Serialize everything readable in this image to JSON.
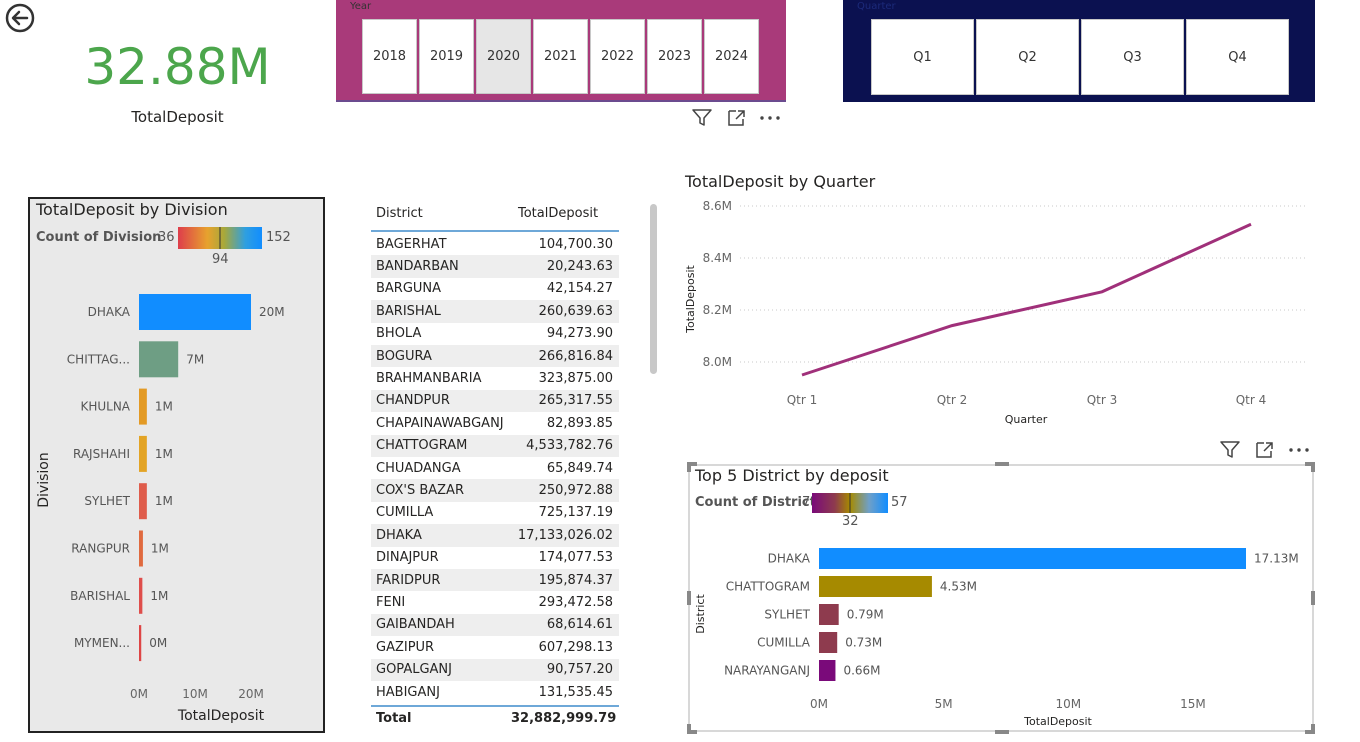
{
  "kpi": {
    "value": "32.88M",
    "label": "TotalDeposit"
  },
  "year_slicer": {
    "label": "Year",
    "years": [
      "2018",
      "2019",
      "2020",
      "2021",
      "2022",
      "2023",
      "2024"
    ],
    "selected": "2020"
  },
  "quarter_slicer": {
    "label": "Quarter",
    "quarters": [
      "Q1",
      "Q2",
      "Q3",
      "Q4"
    ]
  },
  "colors": {
    "kpi_green": "#4CA64C",
    "year_slicer_bg": "#A93A7A",
    "quarter_slicer_bg": "#0B1150",
    "line_color": "#A0307A",
    "table_accent": "#6ea8d8"
  },
  "icons": [
    "back-arrow-icon",
    "filter-icon",
    "focus-mode-icon",
    "more-options-icon"
  ],
  "division_chart": {
    "title": "TotalDeposit by Division",
    "legend_label": "Count of Division",
    "legend_min": "36",
    "legend_mid": "94",
    "legend_max": "152"
  },
  "district_table": {
    "headers": [
      "District",
      "TotalDeposit"
    ],
    "rows": [
      [
        "BAGERHAT",
        "104,700.30"
      ],
      [
        "BANDARBAN",
        "20,243.63"
      ],
      [
        "BARGUNA",
        "42,154.27"
      ],
      [
        "BARISHAL",
        "260,639.63"
      ],
      [
        "BHOLA",
        "94,273.90"
      ],
      [
        "BOGURA",
        "266,816.84"
      ],
      [
        "BRAHMANBARIA",
        "323,875.00"
      ],
      [
        "CHANDPUR",
        "265,317.55"
      ],
      [
        "CHAPAINAWABGANJ",
        "82,893.85"
      ],
      [
        "CHATTOGRAM",
        "4,533,782.76"
      ],
      [
        "CHUADANGA",
        "65,849.74"
      ],
      [
        "COX'S BAZAR",
        "250,972.88"
      ],
      [
        "CUMILLA",
        "725,137.19"
      ],
      [
        "DHAKA",
        "17,133,026.02"
      ],
      [
        "DINAJPUR",
        "174,077.53"
      ],
      [
        "FARIDPUR",
        "195,874.37"
      ],
      [
        "FENI",
        "293,472.58"
      ],
      [
        "GAIBANDAH",
        "68,614.61"
      ],
      [
        "GAZIPUR",
        "607,298.13"
      ],
      [
        "GOPALGANJ",
        "90,757.20"
      ],
      [
        "HABIGANJ",
        "131,535.45"
      ]
    ],
    "total_label": "Total",
    "total_value": "32,882,999.79"
  },
  "quarter_chart": {
    "title": "TotalDeposit by Quarter"
  },
  "top5_chart": {
    "title": "Top 5 District by deposit",
    "legend_label": "Count of District",
    "legend_min": "7",
    "legend_mid": "32",
    "legend_max": "57"
  },
  "chart_data": [
    {
      "type": "bar",
      "orientation": "horizontal",
      "title": "TotalDeposit by Division",
      "xlabel": "TotalDeposit",
      "ylabel": "Division",
      "xlim": [
        0,
        20
      ],
      "xticks": [
        "0M",
        "10M",
        "20M"
      ],
      "categories": [
        "DHAKA",
        "CHITTAG...",
        "KHULNA",
        "RAJSHAHI",
        "SYLHET",
        "RANGPUR",
        "BARISHAL",
        "MYMEN..."
      ],
      "values": [
        20,
        7,
        1,
        1,
        1,
        1,
        1,
        0
      ],
      "bar_lengths": [
        20.0,
        7.0,
        1.4,
        1.4,
        1.4,
        0.7,
        0.6,
        0.4
      ],
      "data_labels": [
        "20M",
        "7M",
        "1M",
        "1M",
        "1M",
        "1M",
        "1M",
        "0M"
      ],
      "bar_colors": [
        "#118DFF",
        "#6E9E84",
        "#E39A25",
        "#E3A425",
        "#DF5C4B",
        "#E06A3F",
        "#DF4E4B",
        "#DE4545"
      ],
      "legend": {
        "title": "Count of Division",
        "min": 36,
        "mid": 94,
        "max": 152
      }
    },
    {
      "type": "line",
      "title": "TotalDeposit by Quarter",
      "xlabel": "Quarter",
      "ylabel": "TotalDeposit",
      "x": [
        "Qtr 1",
        "Qtr 2",
        "Qtr 3",
        "Qtr 4"
      ],
      "values": [
        7.95,
        8.14,
        8.27,
        8.53
      ],
      "units": "M",
      "ylim": [
        7.9,
        8.6
      ],
      "yticks": [
        "8.0M",
        "8.2M",
        "8.4M",
        "8.6M"
      ],
      "grid": true
    },
    {
      "type": "bar",
      "orientation": "horizontal",
      "title": "Top 5 District by deposit",
      "xlabel": "TotalDeposit",
      "ylabel": "District",
      "xlim": [
        0,
        17.8
      ],
      "xticks": [
        "0M",
        "5M",
        "10M",
        "15M"
      ],
      "categories": [
        "DHAKA",
        "CHATTOGRAM",
        "SYLHET",
        "CUMILLA",
        "NARAYANGANJ"
      ],
      "values": [
        17.13,
        4.53,
        0.79,
        0.73,
        0.66
      ],
      "data_labels": [
        "17.13M",
        "4.53M",
        "0.79M",
        "0.73M",
        "0.66M"
      ],
      "bar_colors": [
        "#118DFF",
        "#A68A00",
        "#8E3B4E",
        "#8E3B4E",
        "#7A0A7A"
      ],
      "legend": {
        "title": "Count of District",
        "min": 7,
        "mid": 32,
        "max": 57
      }
    }
  ]
}
